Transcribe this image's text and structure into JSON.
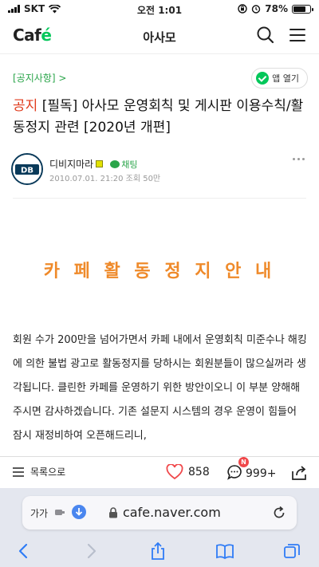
{
  "status_bar": {
    "carrier": "SKT",
    "time": "오전 1:01",
    "battery": "78%",
    "battery_level": 0.78
  },
  "app_header": {
    "logo_text": "Caf",
    "logo_accent": "é",
    "title": "아사모",
    "icons": [
      "search-icon",
      "hamburger-menu-icon"
    ]
  },
  "post": {
    "board_label": "[공지사항] >",
    "open_app_label": "앱 열기",
    "title_prefix": "공지",
    "title": "[필독] 아사모 운영회칙 및 게시판 이용수칙/활동정지 관련 [2020년 개편]",
    "author": {
      "avatar_text": "DB",
      "name": "디비지마라",
      "chat_label": "채팅",
      "date": "2010.07.01. 21:20",
      "views": "조회 50만"
    },
    "heading": "카 페  활 동 정 지 안 내",
    "body": "회원 수가 200만을 넘어가면서 카페 내에서 운영회칙 미준수나 해킹에 의한 불법 광고로 활동정지를 당하시는 회원분들이 많으실꺼라 생각됩니다. 클린한 카페를 운영하기 위한 방안이오니 이 부분 양해해주시면 감사하겠습니다. 기존 설문지 시스템의 경우 운영이 힘들어 잠시 재정비하여 오픈해드리니,"
  },
  "article_toolbar": {
    "list_label": "목록으로",
    "like_count": "858",
    "comment_count": "999+",
    "new_badge": "N"
  },
  "browser": {
    "text_size_label": "가가",
    "url": "cafe.naver.com"
  },
  "colors": {
    "brand_green": "#03c75a",
    "notice_red": "#e03b1c",
    "heading_orange": "#ef8a2a",
    "safari_blue": "#2f7cf6"
  }
}
